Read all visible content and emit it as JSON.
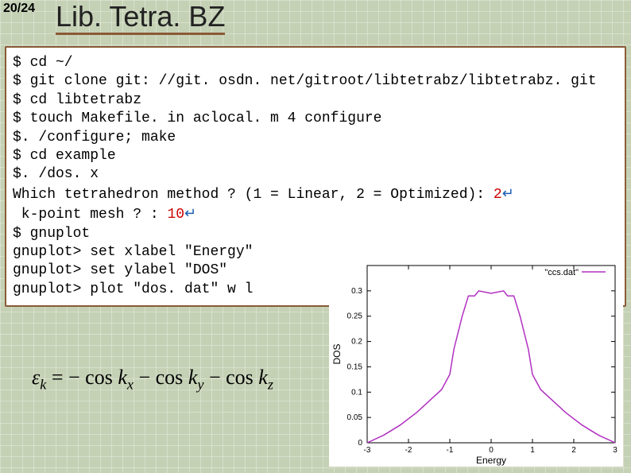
{
  "page_counter": "20/24",
  "title": "Lib. Tetra. BZ",
  "terminal": {
    "lines": [
      "$ cd ~/",
      "$ git clone git: //git. osdn. net/gitroot/libtetrabz/libtetrabz. git",
      "$ cd libtetrabz",
      "$ touch Makefile. in aclocal. m 4 configure",
      "$. /configure; make",
      "$ cd example",
      "$. /dos. x"
    ],
    "prompt1": "Which tetrahedron method ? (1 = Linear, 2 = Optimized): ",
    "answer1": "2",
    "prompt2": " k-point mesh ? : ",
    "answer2": "10",
    "return_glyph": "↵",
    "lines_after": [
      "$ gnuplot",
      "gnuplot> set xlabel \"Energy\"",
      "gnuplot> set ylabel \"DOS\"",
      "gnuplot> plot \"dos. dat\" w l"
    ]
  },
  "formula": {
    "lhs_var": "ε",
    "lhs_sub": "k",
    "eq": " = ",
    "terms": [
      {
        "sign": "−",
        "func": "cos",
        "arg": "k",
        "sub": "x"
      },
      {
        "sign": "−",
        "func": "cos",
        "arg": "k",
        "sub": "y"
      },
      {
        "sign": "−",
        "func": "cos",
        "arg": "k",
        "sub": "z"
      }
    ]
  },
  "chart_data": {
    "type": "line",
    "title": "",
    "xlabel": "Energy",
    "ylabel": "DOS",
    "xlim": [
      -3,
      3
    ],
    "ylim": [
      0,
      0.35
    ],
    "xticks": [
      -3,
      -2,
      -1,
      0,
      1,
      2,
      3
    ],
    "yticks": [
      0,
      0.05,
      0.1,
      0.15,
      0.2,
      0.25,
      0.3
    ],
    "legend_label": "\"ccs.dat\"",
    "legend_color": "#b030c0",
    "series": [
      {
        "name": "ccs.dat",
        "x": [
          -3.0,
          -2.6,
          -2.2,
          -1.8,
          -1.4,
          -1.2,
          -1.0,
          -0.9,
          -0.7,
          -0.55,
          -0.4,
          -0.3,
          0.0,
          0.3,
          0.4,
          0.55,
          0.7,
          0.9,
          1.0,
          1.2,
          1.4,
          1.8,
          2.2,
          2.6,
          3.0
        ],
        "y": [
          0.0,
          0.015,
          0.035,
          0.06,
          0.09,
          0.105,
          0.135,
          0.185,
          0.25,
          0.29,
          0.29,
          0.3,
          0.295,
          0.3,
          0.29,
          0.29,
          0.25,
          0.185,
          0.135,
          0.105,
          0.09,
          0.06,
          0.035,
          0.015,
          0.0
        ]
      }
    ]
  }
}
